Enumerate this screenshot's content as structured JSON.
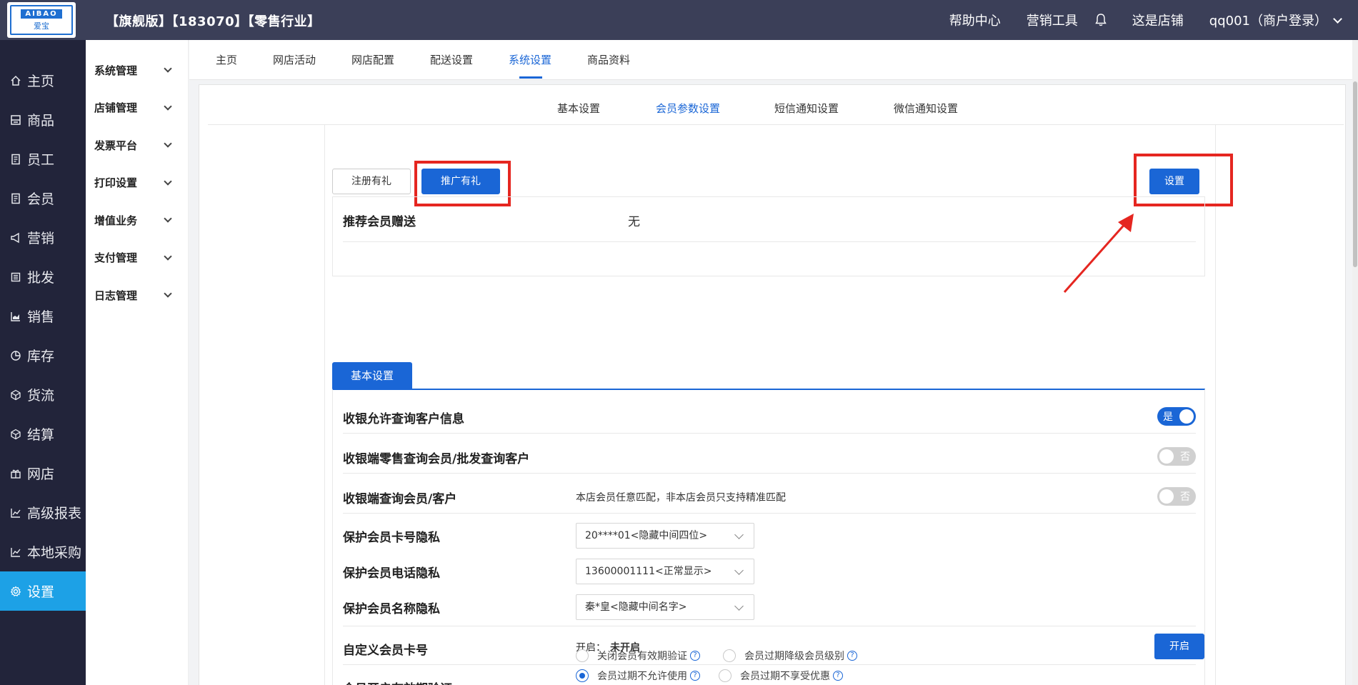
{
  "header": {
    "logo_top": "AIBAO",
    "logo_bottom": "爱宝",
    "store_title": "【旗舰版】【183070】【零售行业】",
    "help": "帮助中心",
    "marketing_tools": "营销工具",
    "this_store": "这是店铺",
    "user": "qq001（商户登录）"
  },
  "sidebar": {
    "items": [
      {
        "label": "主页",
        "icon": "home-icon"
      },
      {
        "label": "商品",
        "icon": "goods-icon"
      },
      {
        "label": "员工",
        "icon": "staff-icon"
      },
      {
        "label": "会员",
        "icon": "member-icon"
      },
      {
        "label": "营销",
        "icon": "megaphone-icon"
      },
      {
        "label": "批发",
        "icon": "wholesale-icon"
      },
      {
        "label": "销售",
        "icon": "chart-icon"
      },
      {
        "label": "库存",
        "icon": "pie-icon"
      },
      {
        "label": "货流",
        "icon": "cube-icon"
      },
      {
        "label": "结算",
        "icon": "settle-icon"
      },
      {
        "label": "网店",
        "icon": "gift-icon"
      },
      {
        "label": "高级报表",
        "icon": "report-icon"
      },
      {
        "label": "本地采购",
        "icon": "purchase-icon"
      },
      {
        "label": "设置",
        "icon": "gear-icon"
      }
    ]
  },
  "subsidebar": {
    "items": [
      "系统管理",
      "店铺管理",
      "发票平台",
      "打印设置",
      "增值业务",
      "支付管理",
      "日志管理"
    ]
  },
  "navtabs": [
    "主页",
    "网店活动",
    "网店配置",
    "配送设置",
    "系统设置",
    "商品资料"
  ],
  "subtabs": [
    "基本设置",
    "会员参数设置",
    "短信通知设置",
    "微信通知设置"
  ],
  "promo": {
    "tab_register": "注册有礼",
    "tab_promote": "推广有礼",
    "settings_button": "设置",
    "referral_label": "推荐会员赠送",
    "referral_value": "无"
  },
  "basic": {
    "tab_label": "基本设置",
    "rows": {
      "r1_label": "收银允许查询客户信息",
      "r1_toggle": "是",
      "r2_label": "收银端零售查询会员/批发查询客户",
      "r2_toggle": "否",
      "r3_label": "收银端查询会员/客户",
      "r3_note": "本店会员任意匹配，非本店会员只支持精准匹配",
      "r3_toggle": "否",
      "r4_label": "保护会员卡号隐私",
      "r4_select": "20****01<隐藏中间四位>",
      "r5_label": "保护会员电话隐私",
      "r5_select": "13600001111<正常显示>",
      "r6_label": "保护会员名称隐私",
      "r6_select": "秦*皇<隐藏中间名字>",
      "r7_label": "自定义会员卡号",
      "r7_status_label": "开启：",
      "r7_status_value": "未开启",
      "r7_button": "开启",
      "r8_label": "会员开启有效期验证",
      "r8_opt1": "会员过期不允许使用",
      "r8_opt2": "会员过期不享受优惠",
      "r8_opt3": "关闭会员有效期验证",
      "r8_opt4": "会员过期降级会员级别"
    }
  },
  "colors": {
    "topbar": "#3b3f58",
    "sidebar": "#22243a",
    "active": "#1da1e6",
    "primary": "#1a66d6",
    "annotation_red": "#e52620"
  }
}
